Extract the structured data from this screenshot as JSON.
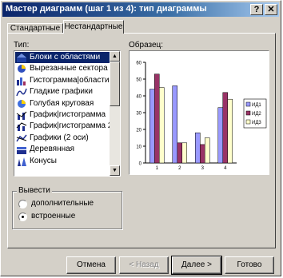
{
  "window": {
    "title": "Мастер диаграмм (шаг 1 из 4): тип диаграммы",
    "help_button": "?",
    "close_button": "✕"
  },
  "tabs": [
    {
      "label": "Стандартные"
    },
    {
      "label": "Нестандартные"
    }
  ],
  "type_label": "Тип:",
  "chart_types": [
    {
      "label": "Блоки с областями",
      "icon": "area-blocks-icon"
    },
    {
      "label": "Вырезанные сектора",
      "icon": "pie-exploded-icon"
    },
    {
      "label": "Гистограмма|области",
      "icon": "column-area-icon"
    },
    {
      "label": "Гладкие графики",
      "icon": "smooth-line-icon"
    },
    {
      "label": "Голубая круговая",
      "icon": "blue-pie-icon"
    },
    {
      "label": "График|гистограмма",
      "icon": "line-column-icon"
    },
    {
      "label": "График|гистограмма 2",
      "icon": "line-column2-icon"
    },
    {
      "label": "Графики (2 оси)",
      "icon": "two-axis-line-icon"
    },
    {
      "label": "Деревянная",
      "icon": "wooden-icon"
    },
    {
      "label": "Конусы",
      "icon": "cones-icon"
    }
  ],
  "selected_index": 0,
  "source_group": {
    "title": "Вывести",
    "options": [
      {
        "label": "дополнительные",
        "checked": false
      },
      {
        "label": "встроенные",
        "checked": true
      }
    ]
  },
  "sample_label": "Образец:",
  "chart_data": {
    "type": "bar",
    "categories": [
      "1",
      "2",
      "3",
      "4"
    ],
    "series": [
      {
        "name": "ИД1",
        "values": [
          44,
          46,
          18,
          33
        ],
        "color": "#9999ff"
      },
      {
        "name": "ИД2",
        "values": [
          53,
          12,
          11,
          42
        ],
        "color": "#993366"
      },
      {
        "name": "ИД3",
        "values": [
          45,
          12,
          15,
          38
        ],
        "color": "#ffffcc"
      }
    ],
    "yticks": [
      "0",
      "10",
      "20",
      "30",
      "40",
      "50",
      "60"
    ],
    "ylim": [
      0,
      60
    ],
    "grid": false,
    "legend_position": "right"
  },
  "buttons": {
    "cancel": "Отмена",
    "back": "< Назад",
    "next": "Далее >",
    "finish": "Готово"
  }
}
